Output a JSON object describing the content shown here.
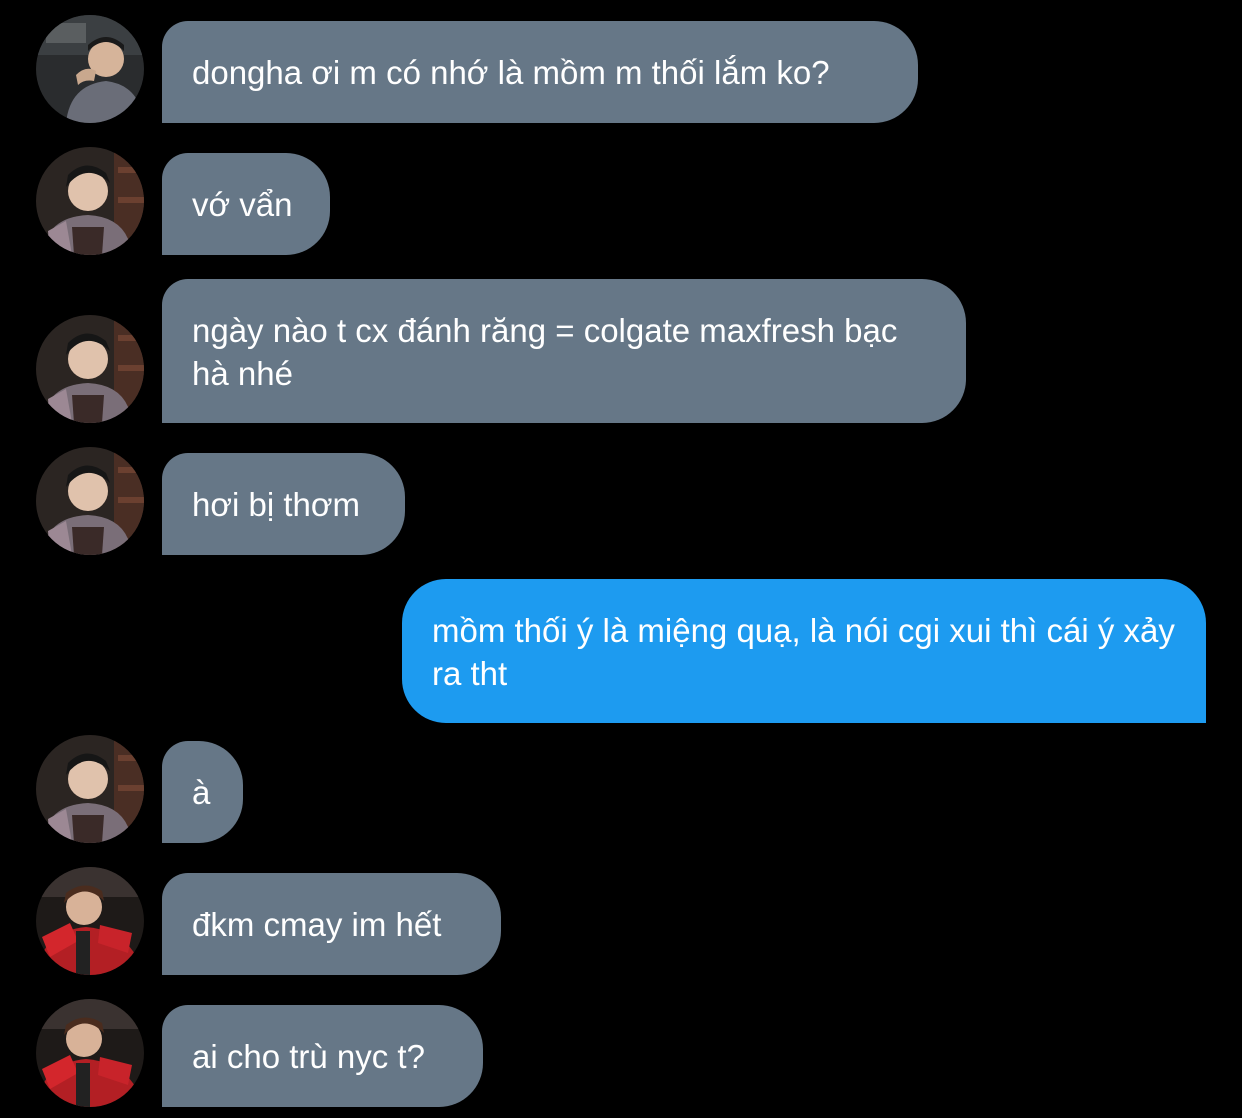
{
  "colors": {
    "background": "#000000",
    "incoming_bubble": "#667787",
    "outgoing_bubble": "#1d9bf0",
    "text": "#ffffff"
  },
  "messages": [
    {
      "direction": "incoming",
      "sender_avatar": "avatar-user-a",
      "text": "dongha ơi m có nhớ là mồm m thối lắm ko?"
    },
    {
      "direction": "incoming",
      "sender_avatar": "avatar-user-b",
      "text": "vớ vẩn"
    },
    {
      "direction": "incoming",
      "sender_avatar": "avatar-user-b",
      "text": "ngày nào t cx đánh răng = colgate maxfresh bạc hà nhé"
    },
    {
      "direction": "incoming",
      "sender_avatar": "avatar-user-b",
      "text": "hơi bị thơm"
    },
    {
      "direction": "outgoing",
      "text": "mồm thối ý là miệng quạ, là nói cgi xui thì cái ý xảy ra tht"
    },
    {
      "direction": "incoming",
      "sender_avatar": "avatar-user-b",
      "text": "à"
    },
    {
      "direction": "incoming",
      "sender_avatar": "avatar-user-c",
      "text": "đkm cmay im hết"
    },
    {
      "direction": "incoming",
      "sender_avatar": "avatar-user-c",
      "text": "ai cho trù nyc t?"
    }
  ]
}
